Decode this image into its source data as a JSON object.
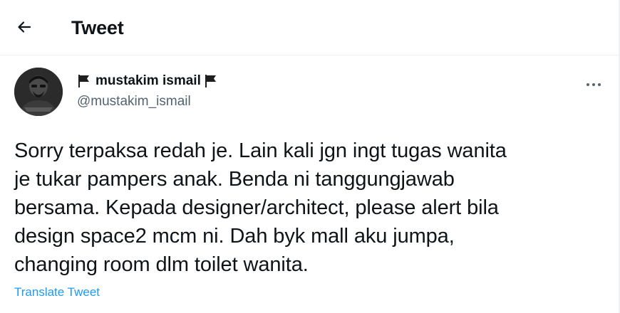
{
  "header": {
    "title": "Tweet",
    "back_icon": "arrow-left-icon"
  },
  "author": {
    "display_name": "mustakim ismail",
    "handle": "@mustakim_ismail",
    "flag_icon": "black-flag-icon",
    "avatar_icon": "avatar"
  },
  "tweet": {
    "text": "Sorry terpaksa redah je. Lain kali jgn ingt tugas wanita\nje tukar pampers anak. Benda ni tanggungjawab\nbersama. Kepada designer/architect, please alert bila\ndesign space2 mcm ni. Dah byk mall aku jumpa,\nchanging room dlm toilet wanita.",
    "translate_label": "Translate Tweet",
    "more_icon": "more-dots-icon"
  },
  "colors": {
    "text": "#0f1419",
    "secondary": "#536471",
    "link": "#1d9bf0",
    "divider": "#eff3f4"
  }
}
